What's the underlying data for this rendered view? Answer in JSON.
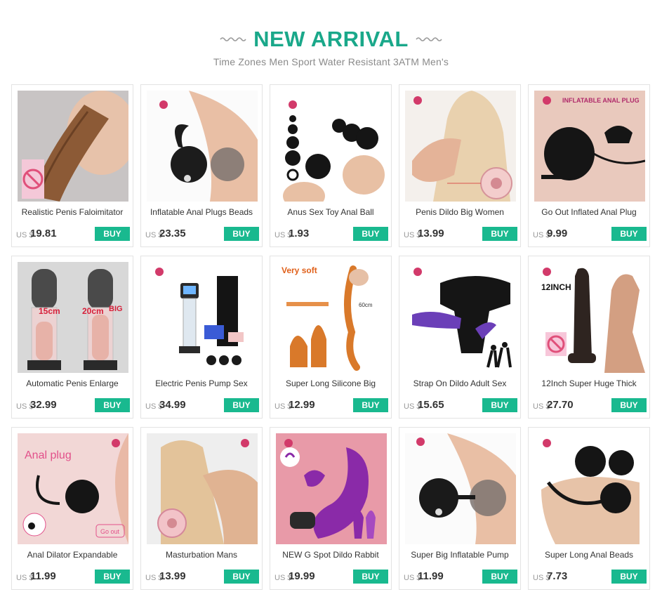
{
  "header": {
    "title": "NEW ARRIVAL",
    "subtitle": "Time Zones Men Sport Water Resistant 3ATM Men's"
  },
  "colors": {
    "accent": "#19b98f",
    "title": "#1aa88a"
  },
  "products": [
    {
      "name": "Realistic Penis Faloimitator",
      "currency": "US $",
      "price": "19.81",
      "buy": "BUY"
    },
    {
      "name": "Inflatable Anal Plugs Beads",
      "currency": "US $",
      "price": "23.35",
      "buy": "BUY"
    },
    {
      "name": "Anus Sex Toy Anal Ball",
      "currency": "US $",
      "price": "1.93",
      "buy": "BUY"
    },
    {
      "name": "Penis Dildo Big Women",
      "currency": "US $",
      "price": "13.99",
      "buy": "BUY"
    },
    {
      "name": "Go Out Inflated Anal Plug",
      "currency": "US $",
      "price": "9.99",
      "buy": "BUY"
    },
    {
      "name": "Automatic Penis Enlarge",
      "currency": "US $",
      "price": "32.99",
      "buy": "BUY"
    },
    {
      "name": "Electric Penis Pump Sex",
      "currency": "US $",
      "price": "34.99",
      "buy": "BUY"
    },
    {
      "name": "Super Long Silicone Big",
      "currency": "US $",
      "price": "12.99",
      "buy": "BUY"
    },
    {
      "name": "Strap On Dildo Adult Sex",
      "currency": "US $",
      "price": "15.65",
      "buy": "BUY"
    },
    {
      "name": "12Inch Super Huge Thick",
      "currency": "US $",
      "price": "27.70",
      "buy": "BUY"
    },
    {
      "name": "Anal Dilator Expandable",
      "currency": "US $",
      "price": "11.99",
      "buy": "BUY"
    },
    {
      "name": "Masturbation Mans",
      "currency": "US $",
      "price": "13.99",
      "buy": "BUY"
    },
    {
      "name": "NEW G Spot Dildo Rabbit",
      "currency": "US $",
      "price": "19.99",
      "buy": "BUY"
    },
    {
      "name": "Super Big Inflatable Pump",
      "currency": "US $",
      "price": "11.99",
      "buy": "BUY"
    },
    {
      "name": "Super Long Anal Beads",
      "currency": "US $",
      "price": "7.73",
      "buy": "BUY"
    }
  ],
  "image_text": {
    "p5": "INFLATABLE ANAL PLUG",
    "p6a": "15cm",
    "p6b": "20cm",
    "p6c": "BIG",
    "p8a": "Very soft",
    "p8b": "60cm",
    "p10": "12INCH",
    "p11a": "Anal plug",
    "p11b": "Go out"
  }
}
